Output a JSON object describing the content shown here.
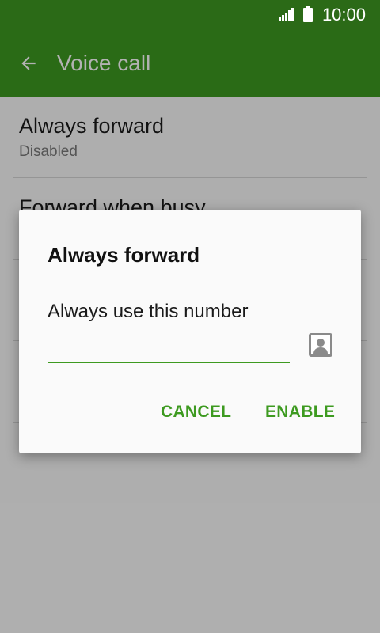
{
  "status_bar": {
    "time": "10:00",
    "signal_icon": "cellular-signal-icon",
    "battery_icon": "battery-icon"
  },
  "app_bar": {
    "title": "Voice call",
    "back_icon": "back-arrow-icon"
  },
  "settings": [
    {
      "title": "Always forward",
      "subtitle": "Disabled"
    },
    {
      "title": "Forward when busy",
      "subtitle": ""
    },
    {
      "title": "",
      "subtitle": ""
    },
    {
      "title": "",
      "subtitle": ""
    }
  ],
  "dialog": {
    "title": "Always forward",
    "label": "Always use this number",
    "input_value": "",
    "contact_icon": "contact-picker-icon",
    "cancel_label": "CANCEL",
    "enable_label": "ENABLE"
  },
  "colors": {
    "status_bar": "#2b6a17",
    "app_bar": "#3d9a20",
    "accent": "#3d9a20"
  }
}
